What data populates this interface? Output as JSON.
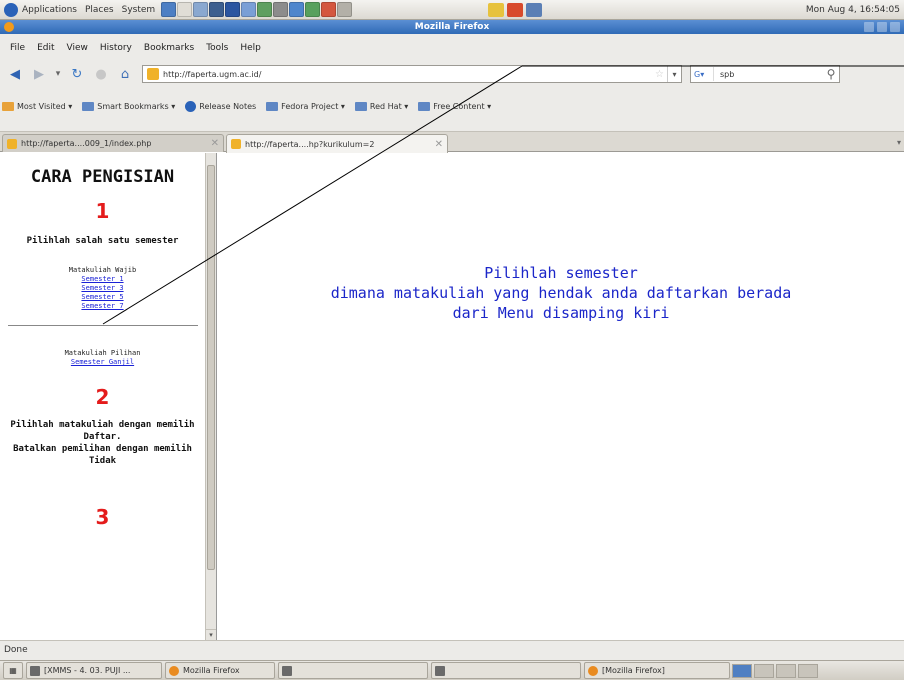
{
  "gnome_panel": {
    "applications": "Applications",
    "places": "Places",
    "system": "System",
    "clock": "Mon Aug  4, 16:54:05"
  },
  "window": {
    "title": "Mozilla Firefox"
  },
  "menubar": [
    "File",
    "Edit",
    "View",
    "History",
    "Bookmarks",
    "Tools",
    "Help"
  ],
  "navbar": {
    "url": "http://faperta.ugm.ac.id/",
    "search_value": "spb"
  },
  "bookmarks": [
    "Most Visited",
    "Smart Bookmarks",
    "Release Notes",
    "Fedora Project",
    "Red Hat",
    "Free Content"
  ],
  "tabs": [
    {
      "label": "http://faperta....009_1/index.php"
    },
    {
      "label": "http://faperta....hp?kurikulum=2"
    }
  ],
  "left_frame": {
    "title": "CARA PENGISIAN",
    "step1_number": "1",
    "step1_text": "Pilihlah salah satu semester",
    "wajib_label": "Matakuliah Wajib",
    "wajib_links": [
      "Semester 1",
      "Semester 3",
      "Semester 5",
      "Semester 7"
    ],
    "pilihan_label": "Matakuliah Pilihan",
    "pilihan_link": "Semester Ganjil",
    "step2_number": "2",
    "step2_text_a": "Pilihlah matakuliah dengan memilih Daftar.",
    "step2_text_b": "Batalkan pemilihan dengan memilih Tidak",
    "step3_number": "3"
  },
  "right_frame": {
    "lines": [
      "Pilihlah semester",
      "dimana matakuliah yang hendak anda daftarkan berada",
      "dari Menu disamping kiri"
    ]
  },
  "statusbar": {
    "text": "Done"
  },
  "taskbar": [
    {
      "label": "[XMMS - 4. 03. PUJI ..."
    },
    {
      "label": "Mozilla Firefox"
    },
    {
      "label": ""
    },
    {
      "label": ""
    },
    {
      "label": "[Mozilla Firefox]"
    }
  ]
}
